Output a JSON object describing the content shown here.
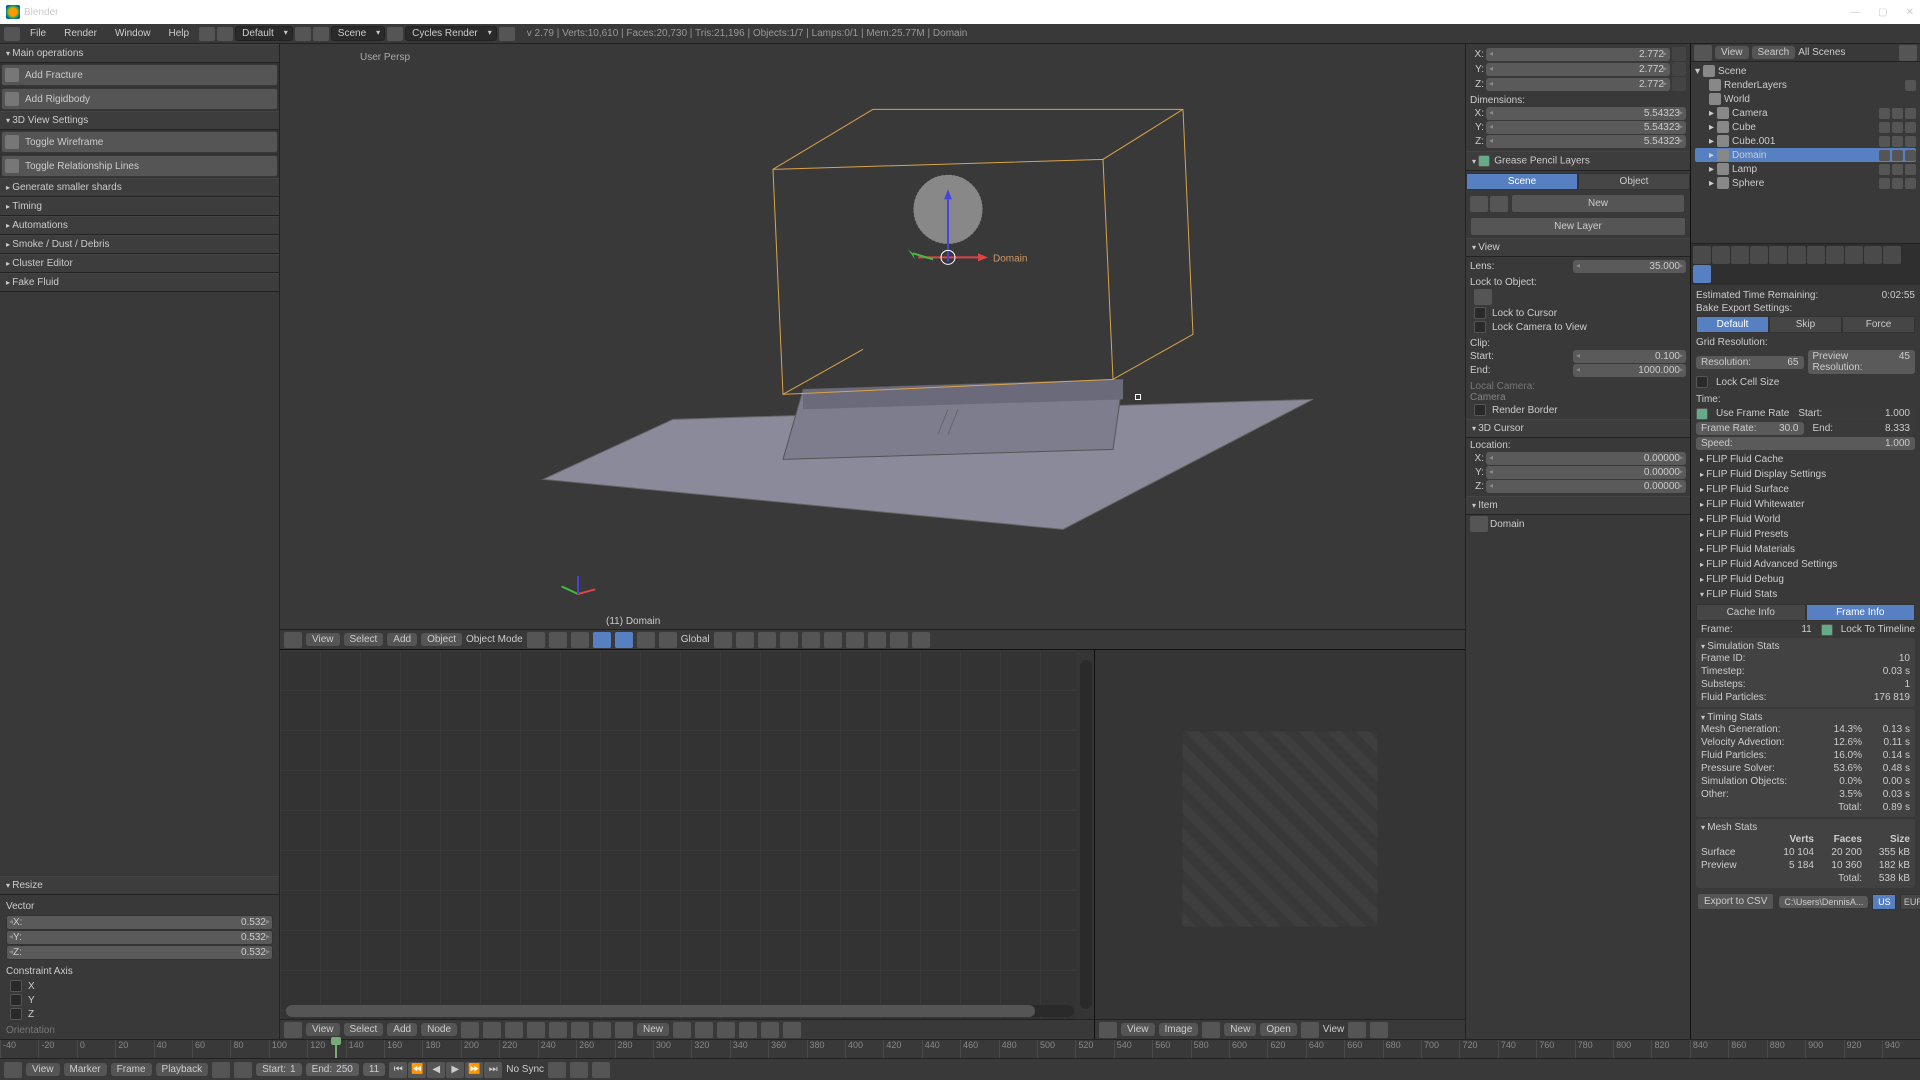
{
  "app": {
    "title": "Blender"
  },
  "menubar": {
    "file": "File",
    "render": "Render",
    "window": "Window",
    "help": "Help",
    "layout": "Default",
    "scene": "Scene",
    "engine": "Cycles Render",
    "status": "v 2.79 | Verts:10,610 | Faces:20,730 | Tris:21,196 | Objects:1/7 | Lamps:0/1 | Mem:25.77M | Domain"
  },
  "left_panel": {
    "main_ops": "Main operations",
    "add_fracture": "Add Fracture",
    "add_rigidbody": "Add Rigidbody",
    "view_settings": "3D View Settings",
    "toggle_wireframe": "Toggle Wireframe",
    "toggle_rel_lines": "Toggle Relationship Lines",
    "collapsed": [
      "Generate smaller shards",
      "Timing",
      "Automations",
      "Smoke / Dust / Debris",
      "Cluster Editor",
      "Fake Fluid"
    ],
    "resize": "Resize",
    "vector": "Vector",
    "vx": "X:",
    "vy": "Y:",
    "vz": "Z:",
    "val": "0.532",
    "constraint": "Constraint Axis",
    "cx": "X",
    "cy": "Y",
    "cz": "Z",
    "orientation": "Orientation"
  },
  "viewport": {
    "persp": "User Persp",
    "objlabel": "(11) Domain"
  },
  "header3d": {
    "view": "View",
    "select": "Select",
    "add": "Add",
    "object": "Object",
    "mode": "Object Mode",
    "orient": "Global"
  },
  "props_n": {
    "x": "X:",
    "y": "Y:",
    "z": "Z:",
    "tval": "2.772",
    "dimensions": "Dimensions:",
    "dval": "5.54323",
    "grease": "Grease Pencil Layers",
    "scene_tab": "Scene",
    "object_tab": "Object",
    "new": "New",
    "new_layer": "New Layer",
    "view": "View",
    "lens": "Lens:",
    "lens_val": "35.000",
    "lock_obj": "Lock to Object:",
    "lock_cursor": "Lock to Cursor",
    "lock_cam": "Lock Camera to View",
    "clip": "Clip:",
    "start": "Start:",
    "start_v": "0.100",
    "end": "End:",
    "end_v": "1000.000",
    "local_cam": "Local Camera:",
    "camera_dd": "Camera",
    "render_border": "Render Border",
    "cursor3d": "3D Cursor",
    "location": "Location:",
    "loc_v": "0.00000",
    "item": "Item",
    "domain": "Domain"
  },
  "outliner": {
    "view": "View",
    "search": "Search",
    "all": "All Scenes",
    "scene": "Scene",
    "layers": "RenderLayers",
    "world": "World",
    "camera": "Camera",
    "cube": "Cube",
    "cube001": "Cube.001",
    "domain": "Domain",
    "lamp": "Lamp",
    "sphere": "Sphere"
  },
  "flip": {
    "bake_remaining": "Estimated Time Remaining:",
    "bake_time": "0:02:55",
    "bake_export": "Bake Export Settings:",
    "default": "Default",
    "skip": "Skip",
    "force": "Force",
    "grid_res": "Grid Resolution:",
    "resolution": "Resolution:",
    "res_v": "65",
    "prev_res": "Preview Resolution:",
    "prev_v": "45",
    "lock_cell": "Lock Cell Size",
    "time": "Time:",
    "use_frame_rate": "Use Frame Rate",
    "start": "Start:",
    "start_v": "1.000",
    "end": "End:",
    "end_v": "8.333",
    "frame_rate": "Frame Rate:",
    "fr_v": "30.0",
    "speed": "Speed:",
    "speed_v": "1.000",
    "sections": [
      "FLIP Fluid Cache",
      "FLIP Fluid Display Settings",
      "FLIP Fluid Surface",
      "FLIP Fluid Whitewater",
      "FLIP Fluid World",
      "FLIP Fluid Presets",
      "FLIP Fluid Materials",
      "FLIP Fluid Advanced Settings",
      "FLIP Fluid Debug",
      "FLIP Fluid Stats"
    ],
    "cache_info": "Cache Info",
    "frame_info": "Frame Info",
    "frame": "Frame:",
    "frame_v": "11",
    "lock_timeline": "Lock To Timeline",
    "sim_stats": "Simulation Stats",
    "frame_id": "Frame ID:",
    "frame_id_v": "10",
    "timestep": "Timestep:",
    "timestep_v": "0.03 s",
    "substeps": "Substeps:",
    "substeps_v": "1",
    "fluid_particles": "Fluid Particles:",
    "fluid_particles_v": "176 819",
    "timing_stats": "Timing Stats",
    "rows": [
      {
        "l": "Mesh Generation:",
        "p": "14.3%",
        "t": "0.13 s"
      },
      {
        "l": "Velocity Advection:",
        "p": "12.6%",
        "t": "0.11 s"
      },
      {
        "l": "Fluid Particles:",
        "p": "16.0%",
        "t": "0.14 s"
      },
      {
        "l": "Pressure Solver:",
        "p": "53.6%",
        "t": "0.48 s"
      },
      {
        "l": "Simulation Objects:",
        "p": "0.0%",
        "t": "0.00 s"
      },
      {
        "l": "Other:",
        "p": "3.5%",
        "t": "0.03 s"
      }
    ],
    "total": "Total:",
    "total_v": "0.89 s",
    "mesh_stats": "Mesh Stats",
    "verts": "Verts",
    "faces": "Faces",
    "size": "Size",
    "surface": "Surface",
    "s_v": "10 104",
    "s_f": "20 200",
    "s_s": "355 kB",
    "preview": "Preview",
    "p_v": "5 184",
    "p_f": "10 360",
    "p_s": "182 kB",
    "mtotal_s": "538 kB",
    "export": "Export to CSV",
    "export_path": "C:\\Users\\DennisA...",
    "us": "US",
    "eur": "EUR"
  },
  "graph_header": {
    "view": "View",
    "select": "Select",
    "add": "Add",
    "node": "Node",
    "new": "New"
  },
  "img_header": {
    "view": "View",
    "image": "Image",
    "new": "New",
    "open": "Open",
    "view2": "View"
  },
  "timeline": {
    "ticks": [
      "-40",
      "-20",
      "0",
      "20",
      "40",
      "60",
      "80",
      "100",
      "120",
      "140",
      "160",
      "180",
      "200",
      "220",
      "240",
      "260",
      "280",
      "300",
      "320",
      "340",
      "360",
      "380",
      "400",
      "420",
      "440",
      "460",
      "480",
      "500",
      "520",
      "540",
      "560",
      "580",
      "600",
      "620",
      "640",
      "660",
      "680",
      "700",
      "720",
      "740",
      "760",
      "780",
      "800",
      "820",
      "840",
      "860",
      "880",
      "900",
      "920",
      "940"
    ]
  },
  "bottombar": {
    "view": "View",
    "marker": "Marker",
    "frame": "Frame",
    "playback": "Playback",
    "start": "Start:",
    "start_v": "1",
    "end": "End:",
    "end_v": "250",
    "cur": "11",
    "nosync": "No Sync"
  }
}
